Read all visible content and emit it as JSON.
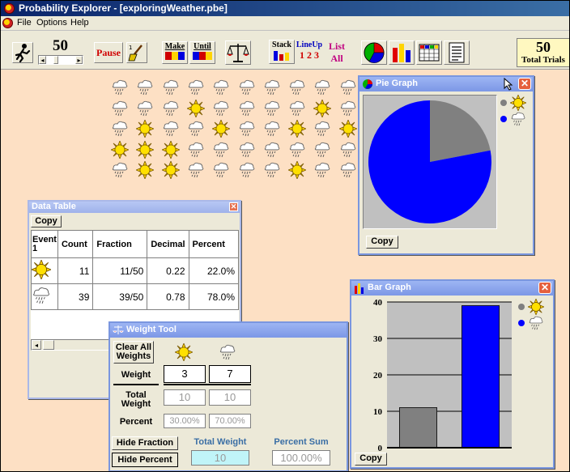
{
  "app": {
    "title": "Probability Explorer - [exploringWeather.pbe]"
  },
  "menu": {
    "items": [
      "File",
      "Options",
      "Help"
    ]
  },
  "toolbar": {
    "speed_value": "50",
    "pause_label": "Pause",
    "make_label": "Make",
    "until_label": "Until",
    "stack_label": "Stack",
    "lineup_label": "LineUp",
    "lineup_sub": "1 2 3",
    "list_label": "List",
    "all_label": "All",
    "total_trials_value": "50",
    "total_trials_label": "Total Trials"
  },
  "outcomes": {
    "grid_rows": [
      [
        "rain",
        "rain",
        "rain",
        "rain",
        "rain",
        "rain",
        "rain",
        "rain",
        "rain",
        "rain"
      ],
      [
        "rain",
        "rain",
        "rain",
        "sun",
        "rain",
        "rain",
        "rain",
        "rain",
        "sun",
        "rain"
      ],
      [
        "rain",
        "sun",
        "rain",
        "rain",
        "sun",
        "rain",
        "rain",
        "sun",
        "rain",
        "sun"
      ],
      [
        "sun",
        "sun",
        "sun",
        "rain",
        "rain",
        "rain",
        "rain",
        "rain",
        "rain",
        "rain"
      ],
      [
        "rain",
        "sun",
        "sun",
        "rain",
        "rain",
        "rain",
        "rain",
        "sun",
        "rain",
        "rain"
      ]
    ]
  },
  "data_table": {
    "title": "Data Table",
    "copy_label": "Copy",
    "headers": [
      "Event 1",
      "Count",
      "Fraction",
      "Decimal",
      "Percent"
    ],
    "rows": [
      {
        "event": "sun",
        "count": "11",
        "fraction": "11/50",
        "decimal": "0.22",
        "percent": "22.0%"
      },
      {
        "event": "rain",
        "count": "39",
        "fraction": "39/50",
        "decimal": "0.78",
        "percent": "78.0%"
      }
    ]
  },
  "pie_graph": {
    "title": "Pie Graph",
    "copy_label": "Copy",
    "legend": [
      {
        "event": "sun",
        "color": "#808080"
      },
      {
        "event": "rain",
        "color": "#0000ff"
      }
    ]
  },
  "bar_graph": {
    "title": "Bar Graph",
    "copy_label": "Copy",
    "legend": [
      {
        "event": "sun",
        "color": "#808080"
      },
      {
        "event": "rain",
        "color": "#0000ff"
      }
    ]
  },
  "weight_tool": {
    "title": "Weight Tool",
    "clear_label": "Clear All Weights",
    "weight_label": "Weight",
    "total_weight_row_label": "Total Weight",
    "percent_row_label": "Percent",
    "weights": [
      "3",
      "7"
    ],
    "total_weights": [
      "10",
      "10"
    ],
    "percents": [
      "30.00%",
      "70.00%"
    ],
    "hide_fraction_label": "Hide Fraction",
    "hide_percent_label": "Hide Percent",
    "total_weight_label": "Total Weight",
    "total_weight_value": "10",
    "percent_sum_label": "Percent Sum",
    "percent_sum_value": "100.00%"
  },
  "chart_data": [
    {
      "type": "pie",
      "categories": [
        "sun",
        "rain"
      ],
      "values": [
        11,
        39
      ],
      "colors": [
        "#808080",
        "#0000ff"
      ]
    },
    {
      "type": "bar",
      "categories": [
        "sun",
        "rain"
      ],
      "values": [
        11,
        39
      ],
      "colors": [
        "#808080",
        "#0000ff"
      ],
      "ylim": [
        0,
        40
      ],
      "yticks": [
        0,
        10,
        20,
        30,
        40
      ],
      "grid": true
    }
  ]
}
